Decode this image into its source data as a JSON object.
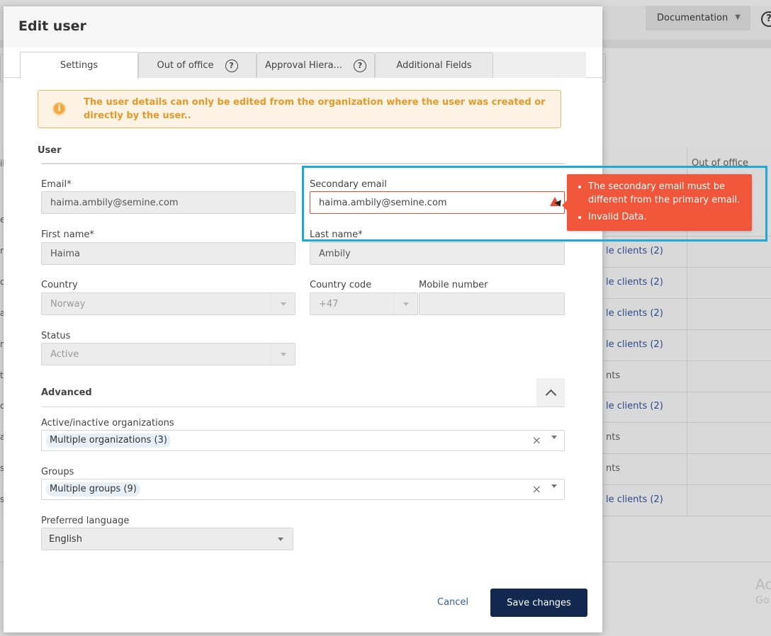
{
  "background": {
    "documentation_label": "Documentation",
    "help_glyph": "?",
    "column_header": "Out of office",
    "cells": [
      "le clients (2)",
      "le clients (2)",
      "le clients (2)",
      "le clients (2)",
      "nts",
      "le clients (2)",
      "nts",
      "nts",
      "le clients (2)"
    ],
    "edge_letters": [
      "il",
      "e",
      "n",
      "o",
      "a",
      "n",
      "t",
      "d",
      "a",
      "s",
      "st"
    ],
    "activate_line1": "Ac",
    "activate_line2": "Go"
  },
  "modal": {
    "title": "Edit user",
    "tabs": [
      {
        "label": "Settings",
        "active": true
      },
      {
        "label": "Out of office",
        "help": "?"
      },
      {
        "label": "Approval Hiera...",
        "help": "?"
      },
      {
        "label": "Additional Fields"
      }
    ],
    "alert": {
      "icon": "info-icon",
      "text": "The user details can only be edited from the organization where the user was created or directly by the user.."
    },
    "user_section": {
      "title": "User",
      "email_label": "Email*",
      "email_value": "haima.ambily@semine.com",
      "secondary_email_label": "Secondary email",
      "secondary_email_value": "haima.ambily@semine.com",
      "first_name_label": "First name*",
      "first_name_value": "Haima",
      "last_name_label": "Last name*",
      "last_name_value": "Ambily",
      "country_label": "Country",
      "country_value": "Norway",
      "country_code_label": "Country code",
      "country_code_value": "+47",
      "mobile_label": "Mobile number",
      "mobile_value": "",
      "status_label": "Status",
      "status_value": "Active"
    },
    "validation_tooltip": {
      "messages": [
        "The secondary email must be different from the primary email.",
        "Invalid Data."
      ],
      "color": "#f0563a"
    },
    "advanced_section": {
      "title": "Advanced",
      "orgs_label": "Active/inactive organizations",
      "orgs_value": "Multiple organizations (3)",
      "groups_label": "Groups",
      "groups_value": "Multiple groups (9)",
      "language_label": "Preferred language",
      "language_value": "English",
      "clear_glyph": "×"
    },
    "footer": {
      "cancel_label": "Cancel",
      "save_label": "Save changes"
    }
  },
  "colors": {
    "primary_button": "#12284f",
    "alert_text": "#e29a2a",
    "error": "#e24c35",
    "highlight": "#21a9d3",
    "link": "#2e5aa7"
  }
}
